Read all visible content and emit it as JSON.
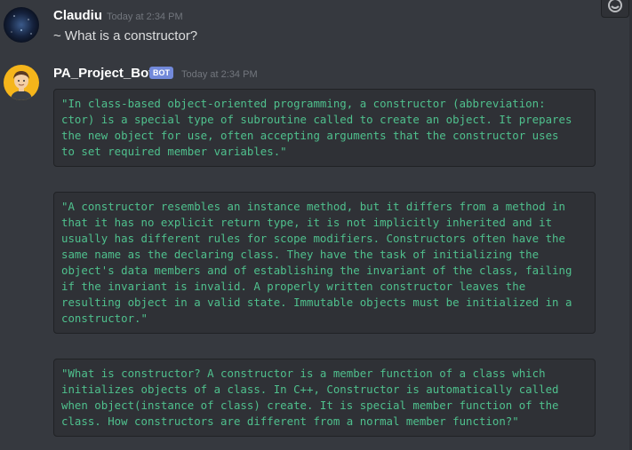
{
  "messages": [
    {
      "author": "Claudiu",
      "timestamp": "Today at 2:34 PM",
      "text": "~ What is a constructor?"
    },
    {
      "author": "PA_Project_Bot",
      "badge": "BOT",
      "timestamp": "Today at 2:34 PM",
      "blocks": [
        "\"In class-based object-oriented programming, a constructor (abbreviation:\nctor) is a special type of subroutine called to create an object. It prepares\nthe new object for use, often accepting arguments that the constructor uses\nto set required member variables.\"",
        "\"A constructor resembles an instance method, but it differs from a method in\nthat it has no explicit return type, it is not implicitly inherited and it\nusually has different rules for scope modifiers. Constructors often have the\nsame name as the declaring class. They have the task of initializing the\nobject's data members and of establishing the invariant of the class, failing\nif the invariant is invalid. A properly written constructor leaves the\nresulting object in a valid state. Immutable objects must be initialized in a\nconstructor.\"",
        "\"What is constructor? A constructor is a member function of a class which\ninitializes objects of a class. In C++, Constructor is automatically called\nwhen object(instance of class) create. It is special member function of the\nclass. How constructors are different from a normal member function?\""
      ]
    }
  ],
  "icons": {
    "corner_button": "add-reaction-icon",
    "user_avatar": "galaxy-avatar",
    "bot_avatar": "cartoon-man-avatar"
  },
  "colors": {
    "background": "#36393f",
    "code_text": "#4fc08d",
    "bot_badge": "#7289da"
  }
}
